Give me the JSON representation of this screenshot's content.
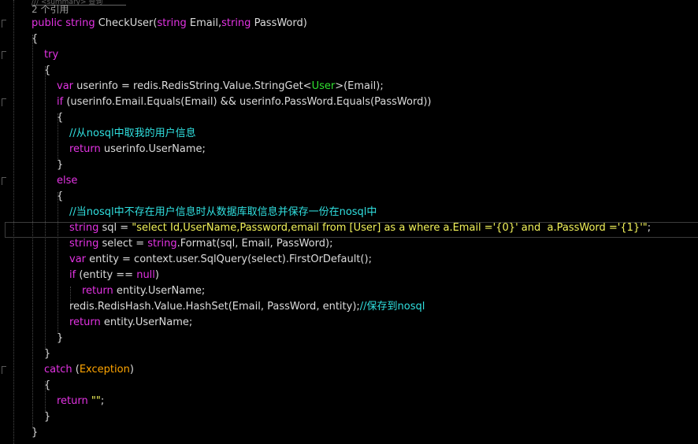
{
  "editor": {
    "header_fragment": "/// <summary> 查询",
    "reference_count": "2 个引用",
    "method_sig": {
      "kw1": "public",
      "type": "string",
      "name": "CheckUser(",
      "ptype1": "string",
      "p1": " Email,",
      "ptype2": "string",
      "p2": " PassWord)"
    },
    "lines": {
      "open1": "{",
      "try": "try",
      "open2": "{",
      "var_kw": "var",
      "var_rest": " userinfo = redis.RedisString.Value.StringGet<",
      "var_user": "User",
      "var_end": ">(Email);",
      "if_kw": "if",
      "if_rest": " (userinfo.Email.Equals(Email) && userinfo.PassWord.Equals(PassWord))",
      "open3": "{",
      "comment1": "//从nosql中取我的用户信息",
      "ret1_kw": "return",
      "ret1_rest": " userinfo.UserName;",
      "close3": "}",
      "else": "else",
      "open4": "{",
      "comment2": "//当nosql中不存在用户信息时从数据库取信息并保存一份在nosql中",
      "sql_kw": "string",
      "sql_rest": " sql = ",
      "sql_str": "\"select Id,UserName,Password,email from [User] as a where a.Email ='{0}' and  a.PassWord ='{1}'\"",
      "sql_end": ";",
      "sel_kw": "string",
      "sel_rest": " select = ",
      "sel_kw2": "string",
      "sel_end": ".Format(sql, Email, PassWord);",
      "ent_kw": "var",
      "ent_rest": " entity = context.user.SqlQuery(select).FirstOrDefault();",
      "if2_kw": "if",
      "if2_rest": " (entity == ",
      "if2_null": "null",
      "if2_end": ")",
      "ret2_kw": "return",
      "ret2_rest": " entity.UserName;",
      "hash_rest": "redis.RedisHash.Value.HashSet(Email, PassWord, entity);",
      "hash_cm": "//保存到nosql",
      "ret3_kw": "return",
      "ret3_rest": " entity.UserName;",
      "close4": "}",
      "close2": "}",
      "catch_kw": "catch",
      "catch_open": " (",
      "catch_type": "Exception",
      "catch_close": ")",
      "open5": "{",
      "ret4_kw": "return",
      "ret4_str": "\"\"",
      "ret4_end": ";",
      "close5": "}",
      "close1": "}"
    }
  },
  "colors": {
    "background": "#000000",
    "keyword": "#e333e3",
    "type_name": "#30e030",
    "string": "#f3f35a",
    "comment": "#30e0e0",
    "text": "#dcdcdc"
  }
}
